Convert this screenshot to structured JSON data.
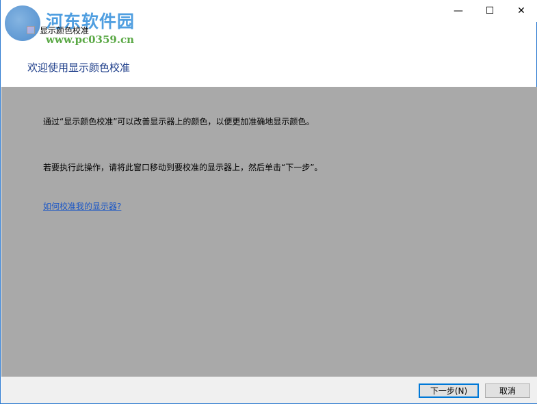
{
  "window": {
    "title": "显示颜色校准",
    "minimize": "—",
    "maximize": "☐",
    "close": "✕"
  },
  "watermark": {
    "name": "河东软件园",
    "url": "www.pc0359.cn"
  },
  "heading": "欢迎使用显示颜色校准",
  "body": {
    "para1": "通过“显示颜色校准”可以改善显示器上的颜色，以便更加准确地显示颜色。",
    "para2": "若要执行此操作，请将此窗口移动到要校准的显示器上，然后单击“下一步”。",
    "help_link": "如何校准我的显示器?"
  },
  "buttons": {
    "next": "下一步(N)",
    "cancel": "取消"
  }
}
